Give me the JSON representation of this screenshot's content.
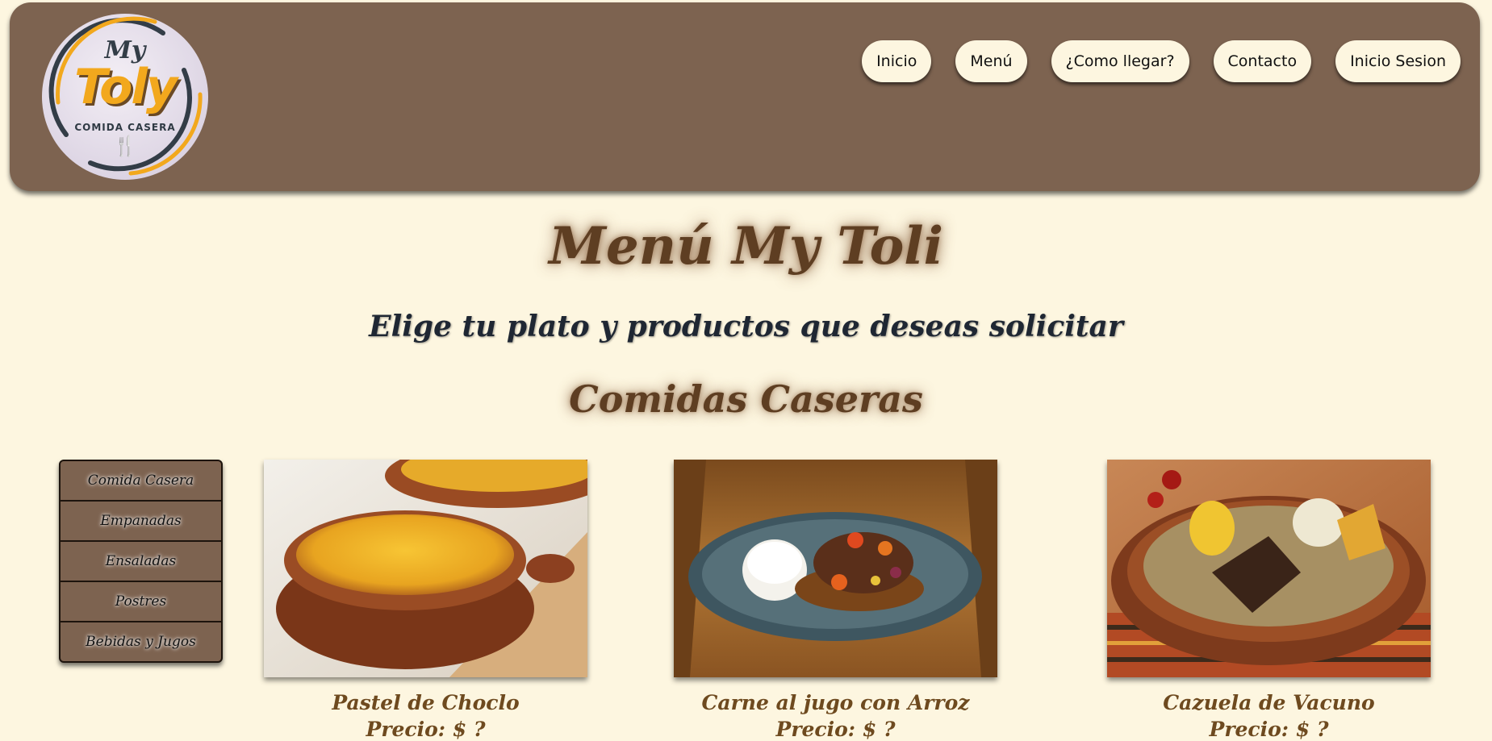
{
  "logo": {
    "line1": "My",
    "line2": "Toly",
    "line3": "COMIDA CASERA",
    "utensils_icon": "fork-spoon-icon"
  },
  "nav": [
    {
      "label": "Inicio"
    },
    {
      "label": "Menú"
    },
    {
      "label": "¿Como llegar?"
    },
    {
      "label": "Contacto"
    },
    {
      "label": "Inicio Sesion"
    }
  ],
  "main": {
    "title": "Menú My Toli",
    "subtitle": "Elige tu plato y productos que deseas solicitar",
    "section_title": "Comidas Caseras"
  },
  "sidebar": {
    "items": [
      {
        "label": "Comida Casera"
      },
      {
        "label": "Empanadas"
      },
      {
        "label": "Ensaladas"
      },
      {
        "label": "Postres"
      },
      {
        "label": "Bebidas y Jugos"
      }
    ]
  },
  "dishes": [
    {
      "name": "Pastel de Choclo",
      "price": "Precio: $ ?"
    },
    {
      "name": "Carne al jugo con Arroz",
      "price": "Precio: $ ?"
    },
    {
      "name": "Cazuela de Vacuno",
      "price": "Precio: $ ?"
    }
  ],
  "colors": {
    "background": "#fdf6e0",
    "header": "#7d6350",
    "title_brown": "#5e3e22",
    "dish_text": "#6e4a1f",
    "logo_orange": "#f2a81d"
  }
}
